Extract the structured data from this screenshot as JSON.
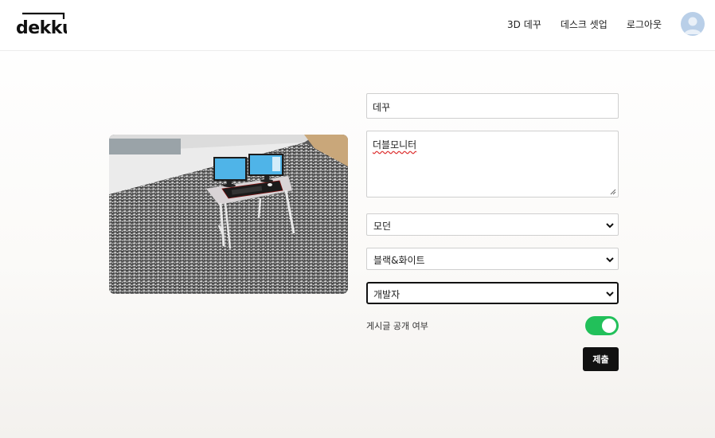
{
  "header": {
    "logo_text": "dekku",
    "nav": {
      "link_3d": "3D 데꾸",
      "link_desk_setup": "데스크 셋업",
      "link_logout": "로그아웃"
    }
  },
  "form": {
    "title_value": "데꾸",
    "description_value": "더블모니터",
    "style_select_value": "모던",
    "color_select_value": "블랙&화이트",
    "job_select_value": "개발자",
    "public_toggle_label": "게시글 공개 여부",
    "public_toggle_on": true,
    "submit_label": "제출"
  },
  "colors": {
    "accent_green": "#22c05a",
    "button_black": "#111111",
    "avatar_blue": "#b9cfe8"
  }
}
